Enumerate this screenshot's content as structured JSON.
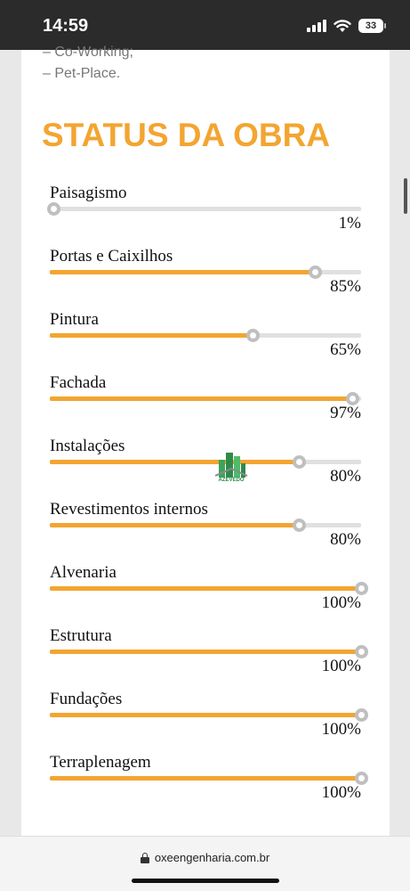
{
  "status_bar": {
    "time": "14:59",
    "battery": "33",
    "icons": [
      "signal-icon",
      "wifi-icon",
      "battery-icon"
    ]
  },
  "amenities": [
    "– Co-Working;",
    "–  Pet-Place."
  ],
  "section_title": "STATUS DA OBRA",
  "colors": {
    "accent": "#f3a531",
    "track": "#e0e0e0",
    "knob_border": "#bfbfbf"
  },
  "progress_items": [
    {
      "label": "Paisagismo",
      "value_text": "1%",
      "percent": 1
    },
    {
      "label": "Portas e Caixilhos",
      "value_text": "85%",
      "percent": 85
    },
    {
      "label": "Pintura",
      "value_text": "65%",
      "percent": 65
    },
    {
      "label": "Fachada",
      "value_text": "97%",
      "percent": 97
    },
    {
      "label": "Instalações",
      "value_text": "80%",
      "percent": 80
    },
    {
      "label": "Revestimentos internos",
      "value_text": "80%",
      "percent": 80
    },
    {
      "label": "Alvenaria",
      "value_text": "100%",
      "percent": 100
    },
    {
      "label": "Estrutura",
      "value_text": "100%",
      "percent": 100
    },
    {
      "label": "Fundações",
      "value_text": "100%",
      "percent": 100
    },
    {
      "label": "Terraplenagem",
      "value_text": "100%",
      "percent": 100
    }
  ],
  "watermark": {
    "name": "AZEVEDO",
    "icon": "buildings-logo-icon"
  },
  "browser": {
    "url": "oxeengenharia.com.br"
  }
}
